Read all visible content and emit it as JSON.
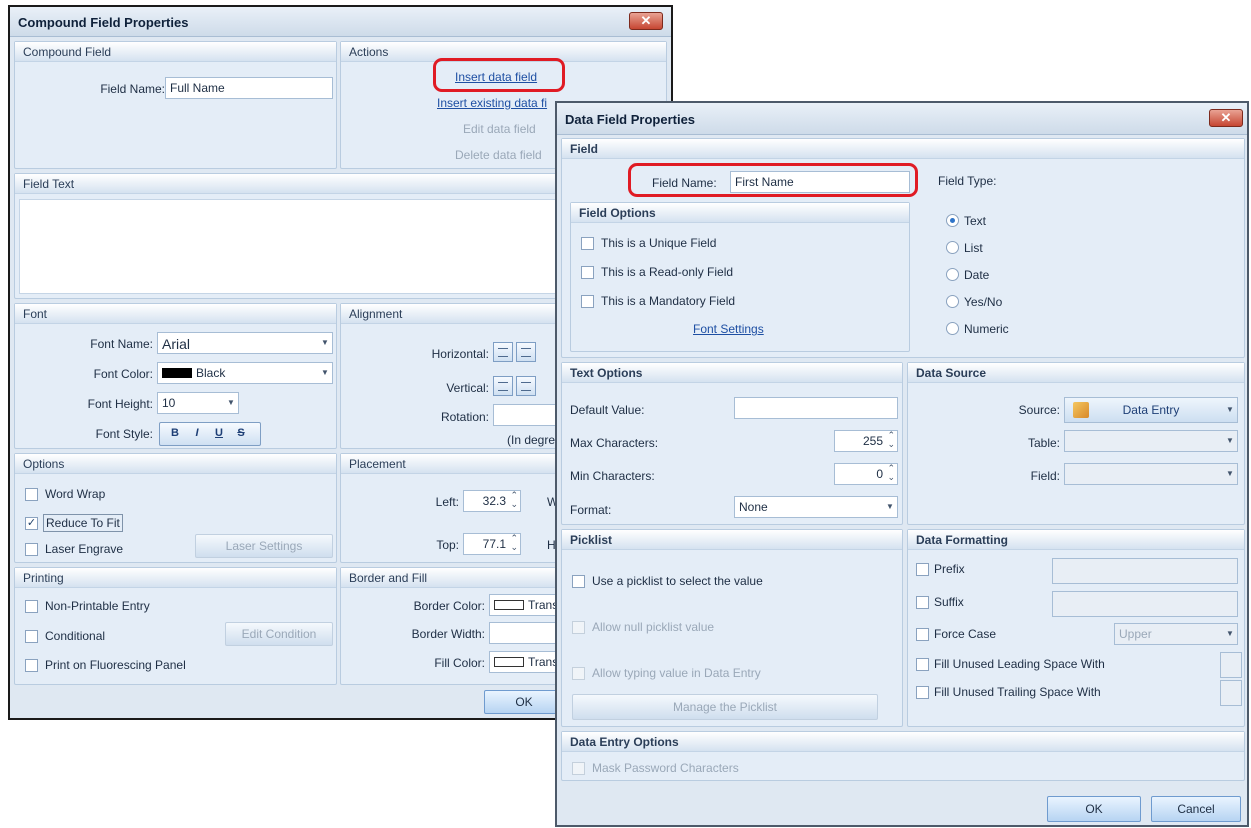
{
  "compound": {
    "title": "Compound Field Properties",
    "close": "✕",
    "compound_field": {
      "header": "Compound Field",
      "field_name_label": "Field Name:",
      "field_name_value": "Full Name"
    },
    "actions": {
      "header": "Actions",
      "insert_data_field": "Insert data field",
      "insert_existing": "Insert existing data fi",
      "edit": "Edit data field",
      "delete": "Delete data field"
    },
    "field_text": {
      "header": "Field Text"
    },
    "font": {
      "header": "Font",
      "name_label": "Font Name:",
      "name_value": "Arial",
      "color_label": "Font Color:",
      "color_value": "Black",
      "height_label": "Font Height:",
      "height_value": "10",
      "style_label": "Font Style:",
      "styles": [
        "B",
        "I",
        "U",
        "S"
      ]
    },
    "alignment": {
      "header": "Alignment",
      "horizontal": "Horizontal:",
      "vertical": "Vertical:",
      "rotation": "Rotation:",
      "degrees": "(In degrees"
    },
    "options": {
      "header": "Options",
      "word_wrap": "Word Wrap",
      "reduce_to_fit": "Reduce To Fit",
      "laser_engrave": "Laser Engrave",
      "laser_settings": "Laser Settings"
    },
    "placement": {
      "header": "Placement",
      "left_label": "Left:",
      "left_value": "32.3",
      "top_label": "Top:",
      "top_value": "77.1",
      "w_label": "W",
      "he_label": "He"
    },
    "printing": {
      "header": "Printing",
      "non_printable": "Non-Printable Entry",
      "conditional": "Conditional",
      "edit_condition": "Edit Condition",
      "fluorescing": "Print on Fluorescing Panel"
    },
    "border_fill": {
      "header": "Border and Fill",
      "border_color": "Border Color:",
      "border_color_value": "Transp",
      "border_width": "Border Width:",
      "fill_color": "Fill Color:",
      "fill_color_value": "Transp"
    },
    "ok": "OK"
  },
  "datafield": {
    "title": "Data Field Properties",
    "close": "✕",
    "field": {
      "header": "Field",
      "name_label": "Field Name:",
      "name_value": "First Name",
      "type_label": "Field Type:",
      "types": [
        "Text",
        "List",
        "Date",
        "Yes/No",
        "Numeric"
      ],
      "selected_type": "Text"
    },
    "field_options": {
      "header": "Field Options",
      "unique": "This is a Unique Field",
      "readonly": "This is a Read-only Field",
      "mandatory": "This is a Mandatory Field",
      "font_settings": "Font Settings"
    },
    "text_options": {
      "header": "Text Options",
      "default_label": "Default Value:",
      "default_value": "",
      "max_label": "Max Characters:",
      "max_value": "255",
      "min_label": "Min Characters:",
      "min_value": "0",
      "format_label": "Format:",
      "format_value": "None"
    },
    "data_source": {
      "header": "Data Source",
      "source_label": "Source:",
      "source_value": "Data Entry",
      "table_label": "Table:",
      "field_label": "Field:"
    },
    "picklist": {
      "header": "Picklist",
      "use": "Use a picklist to select the value",
      "allow_null": "Allow null picklist value",
      "allow_typing": "Allow typing value in Data Entry",
      "manage": "Manage the Picklist"
    },
    "data_formatting": {
      "header": "Data Formatting",
      "prefix": "Prefix",
      "suffix": "Suffix",
      "force_case": "Force Case",
      "force_case_value": "Upper",
      "leading": "Fill Unused Leading Space With",
      "trailing": "Fill Unused Trailing Space With"
    },
    "data_entry": {
      "header": "Data Entry Options",
      "mask": "Mask Password Characters"
    },
    "ok": "OK",
    "cancel": "Cancel"
  },
  "colors": {
    "highlight_ring": "#e01b24",
    "link": "#1e4fa3",
    "window_bg": "#dfe8f2"
  },
  "icons": [
    "close-icon",
    "chevron-down-icon",
    "spin-arrows-icon",
    "checkbox-icon",
    "radio-icon",
    "data-entry-icon",
    "align-icon"
  ]
}
